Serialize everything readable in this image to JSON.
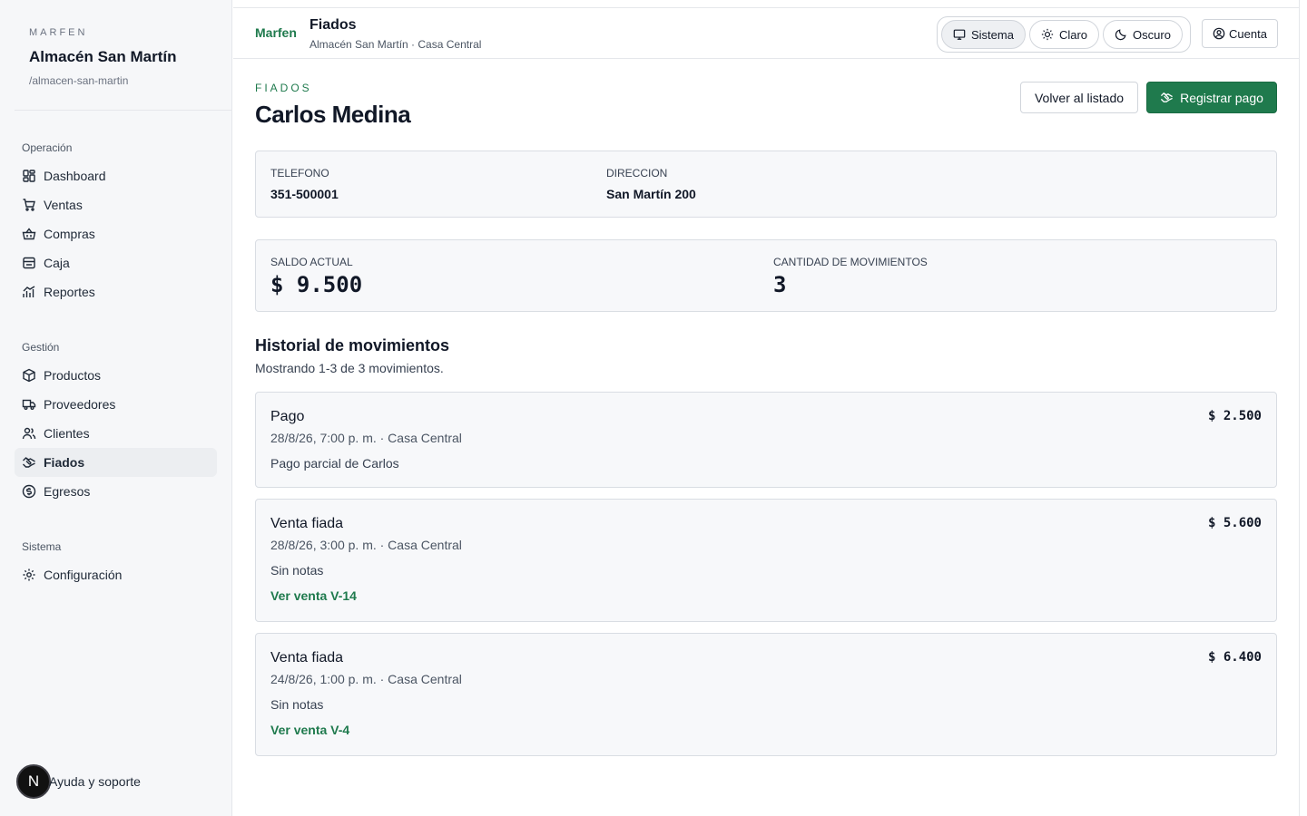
{
  "sidebar": {
    "kicker": "MARFEN",
    "store_name": "Almacén San Martín",
    "store_slug": "/almacen-san-martin",
    "groups": [
      {
        "label": "Operación",
        "items": [
          {
            "label": "Dashboard",
            "icon": "dashboard-icon"
          },
          {
            "label": "Ventas",
            "icon": "cart-icon"
          },
          {
            "label": "Compras",
            "icon": "basket-icon"
          },
          {
            "label": "Caja",
            "icon": "cash-register-icon"
          },
          {
            "label": "Reportes",
            "icon": "chart-icon"
          }
        ]
      },
      {
        "label": "Gestión",
        "items": [
          {
            "label": "Productos",
            "icon": "box-icon"
          },
          {
            "label": "Proveedores",
            "icon": "truck-icon"
          },
          {
            "label": "Clientes",
            "icon": "users-icon"
          },
          {
            "label": "Fiados",
            "icon": "handshake-icon",
            "active": true
          },
          {
            "label": "Egresos",
            "icon": "dollar-circle-icon"
          }
        ]
      },
      {
        "label": "Sistema",
        "items": [
          {
            "label": "Configuración",
            "icon": "gear-icon"
          }
        ]
      }
    ],
    "help": {
      "avatar_letter": "N",
      "label": "Ayuda y soporte"
    }
  },
  "topbar": {
    "brand": "Marfen",
    "title": "Fiados",
    "subtitle": "Almacén San Martín · Casa Central",
    "theme": {
      "system": "Sistema",
      "light": "Claro",
      "dark": "Oscuro"
    },
    "account": "Cuenta"
  },
  "page": {
    "kicker": "FIADOS",
    "title": "Carlos Medina",
    "back_button": "Volver al listado",
    "pay_button": "Registrar pago"
  },
  "customer": {
    "phone_label": "TELEFONO",
    "phone": "351-500001",
    "address_label": "DIRECCION",
    "address": "San Martín 200"
  },
  "stats": {
    "balance_label": "SALDO ACTUAL",
    "balance": "$ 9.500",
    "count_label": "CANTIDAD DE MOVIMIENTOS",
    "count": "3"
  },
  "history": {
    "title": "Historial de movimientos",
    "subtitle": "Mostrando 1-3 de 3 movimientos.",
    "movements": [
      {
        "type": "Pago",
        "meta": "28/8/26, 7:00 p. m. · Casa Central",
        "note": "Pago parcial de Carlos",
        "amount": "$ 2.500",
        "link": ""
      },
      {
        "type": "Venta fiada",
        "meta": "28/8/26, 3:00 p. m. · Casa Central",
        "note": "Sin notas",
        "amount": "$ 5.600",
        "link": "Ver venta V-14"
      },
      {
        "type": "Venta fiada",
        "meta": "24/8/26, 1:00 p. m. · Casa Central",
        "note": "Sin notas",
        "amount": "$ 6.400",
        "link": "Ver venta V-4"
      }
    ]
  }
}
